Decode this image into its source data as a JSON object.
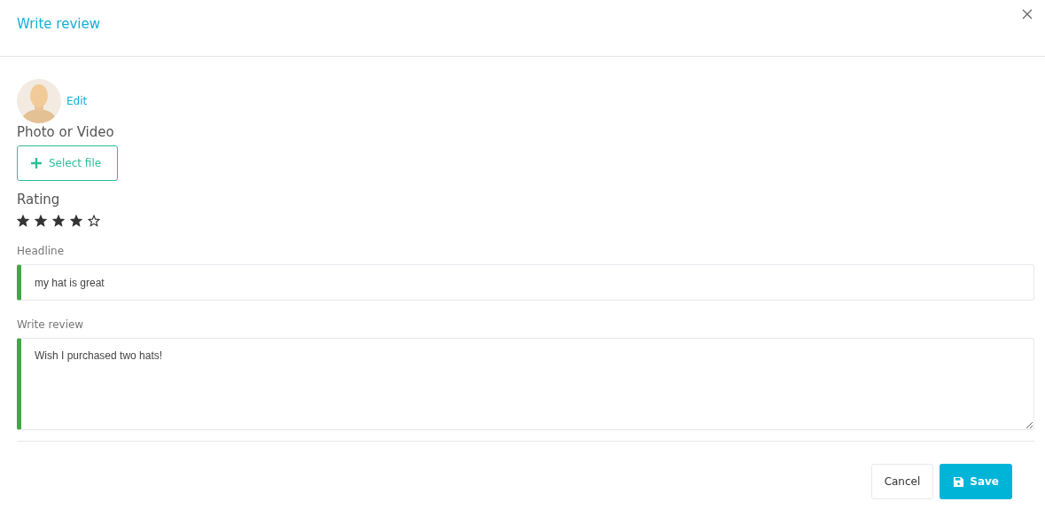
{
  "dialog": {
    "title": "Write review"
  },
  "avatar": {
    "edit_link": "Edit"
  },
  "media": {
    "label": "Photo or Video",
    "button": "Select file"
  },
  "rating": {
    "label": "Rating",
    "stars": 4
  },
  "fields": [
    {
      "kind": "input",
      "label": "Headline",
      "value": "my hat is great",
      "valid": true
    },
    {
      "kind": "textarea",
      "label": "Write review",
      "value": "Wish I purchased two hats!",
      "valid": true
    }
  ],
  "buttons": [
    {
      "kind": "secondary",
      "label": "Cancel"
    },
    {
      "kind": "primary",
      "label": "Save"
    }
  ]
}
